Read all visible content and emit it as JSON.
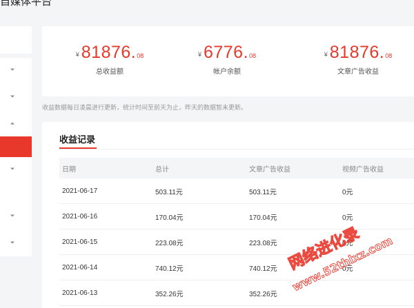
{
  "header": {
    "title": "自媒体平台"
  },
  "sidebar": {
    "items": [
      {
        "chevron": "down"
      },
      {
        "chevron": "down"
      },
      {
        "chevron": "up"
      },
      {
        "active": true
      },
      {
        "chevron": "down"
      },
      {
        "chevron": "down"
      },
      {
        "chevron": "down"
      }
    ]
  },
  "stats": [
    {
      "currency": "¥",
      "integer": "81876.",
      "decimal": "08",
      "label": "总收益额"
    },
    {
      "currency": "¥",
      "integer": "6776.",
      "decimal": "08",
      "label": "帐户余额"
    },
    {
      "currency": "¥",
      "integer": "81876.",
      "decimal": "08",
      "label": "文章广告收益"
    }
  ],
  "note": "收益数据每日凌晨进行更新，统计时间至前天为止，昨天的数据暂未更新。",
  "records": {
    "title": "收益记录",
    "columns": [
      "日期",
      "总计",
      "文章广告收益",
      "视频广告收益"
    ],
    "rows": [
      [
        "2021-06-17",
        "503.11元",
        "503.11元",
        "0元"
      ],
      [
        "2021-06-16",
        "170.04元",
        "170.04元",
        "0元"
      ],
      [
        "2021-06-15",
        "223.08元",
        "223.08元",
        "0元"
      ],
      [
        "2021-06-14",
        "740.12元",
        "740.12元",
        "0元"
      ],
      [
        "2021-06-13",
        "352.26元",
        "352.26元",
        ""
      ]
    ]
  },
  "watermark": {
    "text1": "网络进化录",
    "text2": "www.52thlxz.com"
  },
  "colors": {
    "accent": "#e8372b",
    "background": "#f4f5f6"
  }
}
